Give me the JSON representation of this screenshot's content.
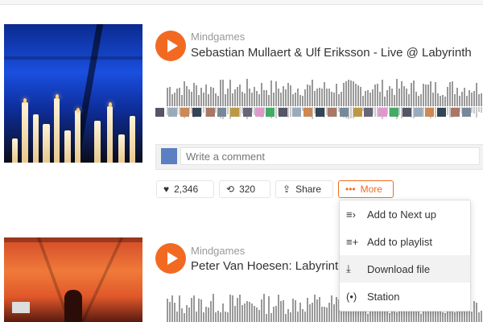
{
  "tracks": [
    {
      "user": "Mindgames",
      "title": "Sebastian Mullaert & Ulf Eriksson - Live @ Labyrinth",
      "art_colors": [
        "#0b2a8f",
        "#1a4fe0",
        "#0a0d1a"
      ]
    },
    {
      "user": "Mindgames",
      "title": "Peter Van Hoesen: Labyrinth Live",
      "art_colors": [
        "#d44a28",
        "#f07a3a",
        "#5a1a10"
      ]
    }
  ],
  "comment": {
    "placeholder": "Write a comment"
  },
  "actions": {
    "likes": "2,346",
    "reposts": "320",
    "share": "Share",
    "more": "More",
    "icons": {
      "like": "heart-icon",
      "repost": "repost-icon",
      "share": "share-icon",
      "more": "ellipsis-icon"
    }
  },
  "more_menu": {
    "items": [
      {
        "label": "Add to Next up",
        "icon": "next-up-icon"
      },
      {
        "label": "Add to playlist",
        "icon": "playlist-add-icon"
      },
      {
        "label": "Download file",
        "icon": "download-icon"
      },
      {
        "label": "Station",
        "icon": "station-icon"
      }
    ],
    "hovered_index": 2
  },
  "colors": {
    "accent": "#f26a22",
    "waveform": "#999999",
    "text_muted": "#999999"
  }
}
